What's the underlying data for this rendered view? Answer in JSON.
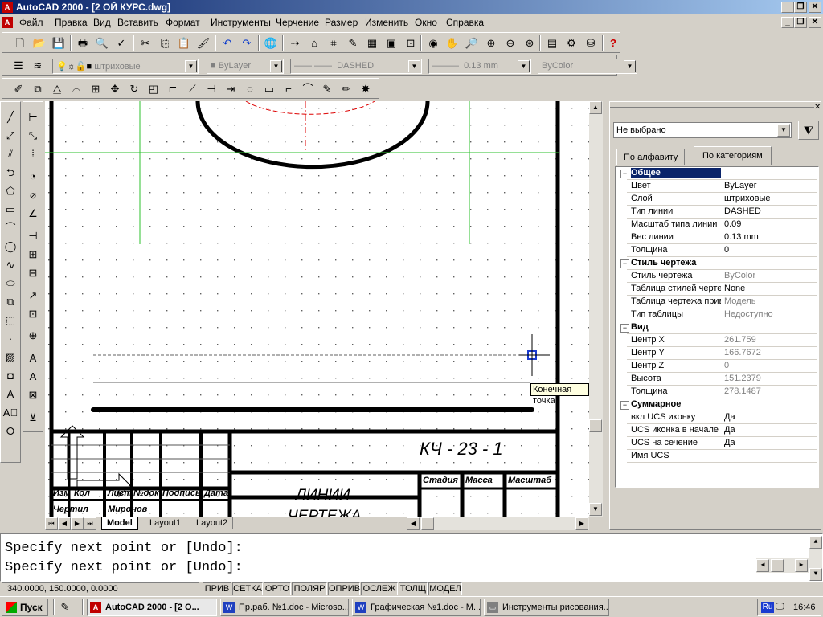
{
  "window": {
    "title": "AutoCAD 2000 - [2 ОЙ КУРС.dwg]",
    "minimize": "_",
    "restore": "❐",
    "close": "✕"
  },
  "menu": [
    {
      "label": "Файл"
    },
    {
      "label": "Правка"
    },
    {
      "label": "Вид"
    },
    {
      "label": "Вставить"
    },
    {
      "label": "Формат"
    },
    {
      "label": "Инструменты"
    },
    {
      "label": "Черчение"
    },
    {
      "label": "Размер"
    },
    {
      "label": "Изменить"
    },
    {
      "label": "Окно"
    },
    {
      "label": "Справка"
    }
  ],
  "layer_toolbar": {
    "layer": "штриховые",
    "color": "ByLayer",
    "linetype": "DASHED",
    "lineweight": "0.13 mm",
    "plotstyle": "ByColor"
  },
  "drawing": {
    "doc_code": "КЧ - 23 - 1",
    "title_line1": "ЛИНИИ",
    "title_line2": "ЧЕРТЕЖА",
    "header_stage": "Стадия",
    "header_mass": "Масса",
    "header_scale": "Масштаб",
    "row_labels": [
      "Изм",
      "Кол",
      "Лист",
      "№док",
      "Подпись",
      "Дата"
    ],
    "drafted_label": "Чертил",
    "drafted_name": "Миронов",
    "tooltip": "Конечная точка"
  },
  "layout_tabs": [
    {
      "label": "Model",
      "active": true
    },
    {
      "label": "Layout1",
      "active": false
    },
    {
      "label": "Layout2",
      "active": false
    }
  ],
  "properties": {
    "selection": "Не выбрано",
    "tab_alpha": "По алфавиту",
    "tab_category": "По категориям",
    "rows": [
      {
        "k": "Общее",
        "v": "",
        "cat": true
      },
      {
        "k": "Цвет",
        "v": "ByLayer"
      },
      {
        "k": "Слой",
        "v": "штриховые"
      },
      {
        "k": "Тип линии",
        "v": "DASHED"
      },
      {
        "k": "Масштаб типа линии",
        "v": "0.09"
      },
      {
        "k": "Вес линии",
        "v": "0.13 mm"
      },
      {
        "k": "Толщина",
        "v": "0"
      },
      {
        "k": "Стиль чертежа",
        "v": "",
        "cat": true
      },
      {
        "k": "Стиль чертежа",
        "v": "ByColor",
        "grey": true
      },
      {
        "k": "Таблица стилей черте",
        "v": "None"
      },
      {
        "k": "Таблица чертежа прив",
        "v": "Модель",
        "grey": true
      },
      {
        "k": "Тип таблицы",
        "v": "Недоступно",
        "grey": true
      },
      {
        "k": "Вид",
        "v": "",
        "cat": true
      },
      {
        "k": "Центр X",
        "v": "261.759",
        "grey": true
      },
      {
        "k": "Центр Y",
        "v": "166.7672",
        "grey": true
      },
      {
        "k": "Центр Z",
        "v": "0",
        "grey": true
      },
      {
        "k": "Высота",
        "v": "151.2379",
        "grey": true
      },
      {
        "k": "Толщина",
        "v": "278.1487",
        "grey": true
      },
      {
        "k": "Суммарное",
        "v": "",
        "cat": true
      },
      {
        "k": "вкл UCS иконку",
        "v": "Да"
      },
      {
        "k": "UCS иконка в начале к",
        "v": "Да"
      },
      {
        "k": "UCS на сечение",
        "v": "Да"
      },
      {
        "k": "Имя UCS",
        "v": ""
      }
    ]
  },
  "command": {
    "line1": "Specify next point or [Undo]:",
    "line2": "Specify next point or [Undo]:"
  },
  "status": {
    "coords": "340.0000, 150.0000, 0.0000",
    "buttons": [
      "ПРИВ",
      "СЕТКА",
      "ОРТО",
      "ПОЛЯР",
      "ОПРИВ",
      "ОСЛЕЖ",
      "ТОЛЩ",
      "МОДЕЛ"
    ]
  },
  "taskbar": {
    "start": "Пуск",
    "tasks": [
      {
        "label": "AutoCAD 2000 - [2 O...",
        "active": true
      },
      {
        "label": "Пр.раб. №1.doc - Microso..."
      },
      {
        "label": "Графическая №1.doc - M..."
      },
      {
        "label": "Инструменты рисования..."
      }
    ],
    "lang": "Ru",
    "clock": "16:46"
  }
}
